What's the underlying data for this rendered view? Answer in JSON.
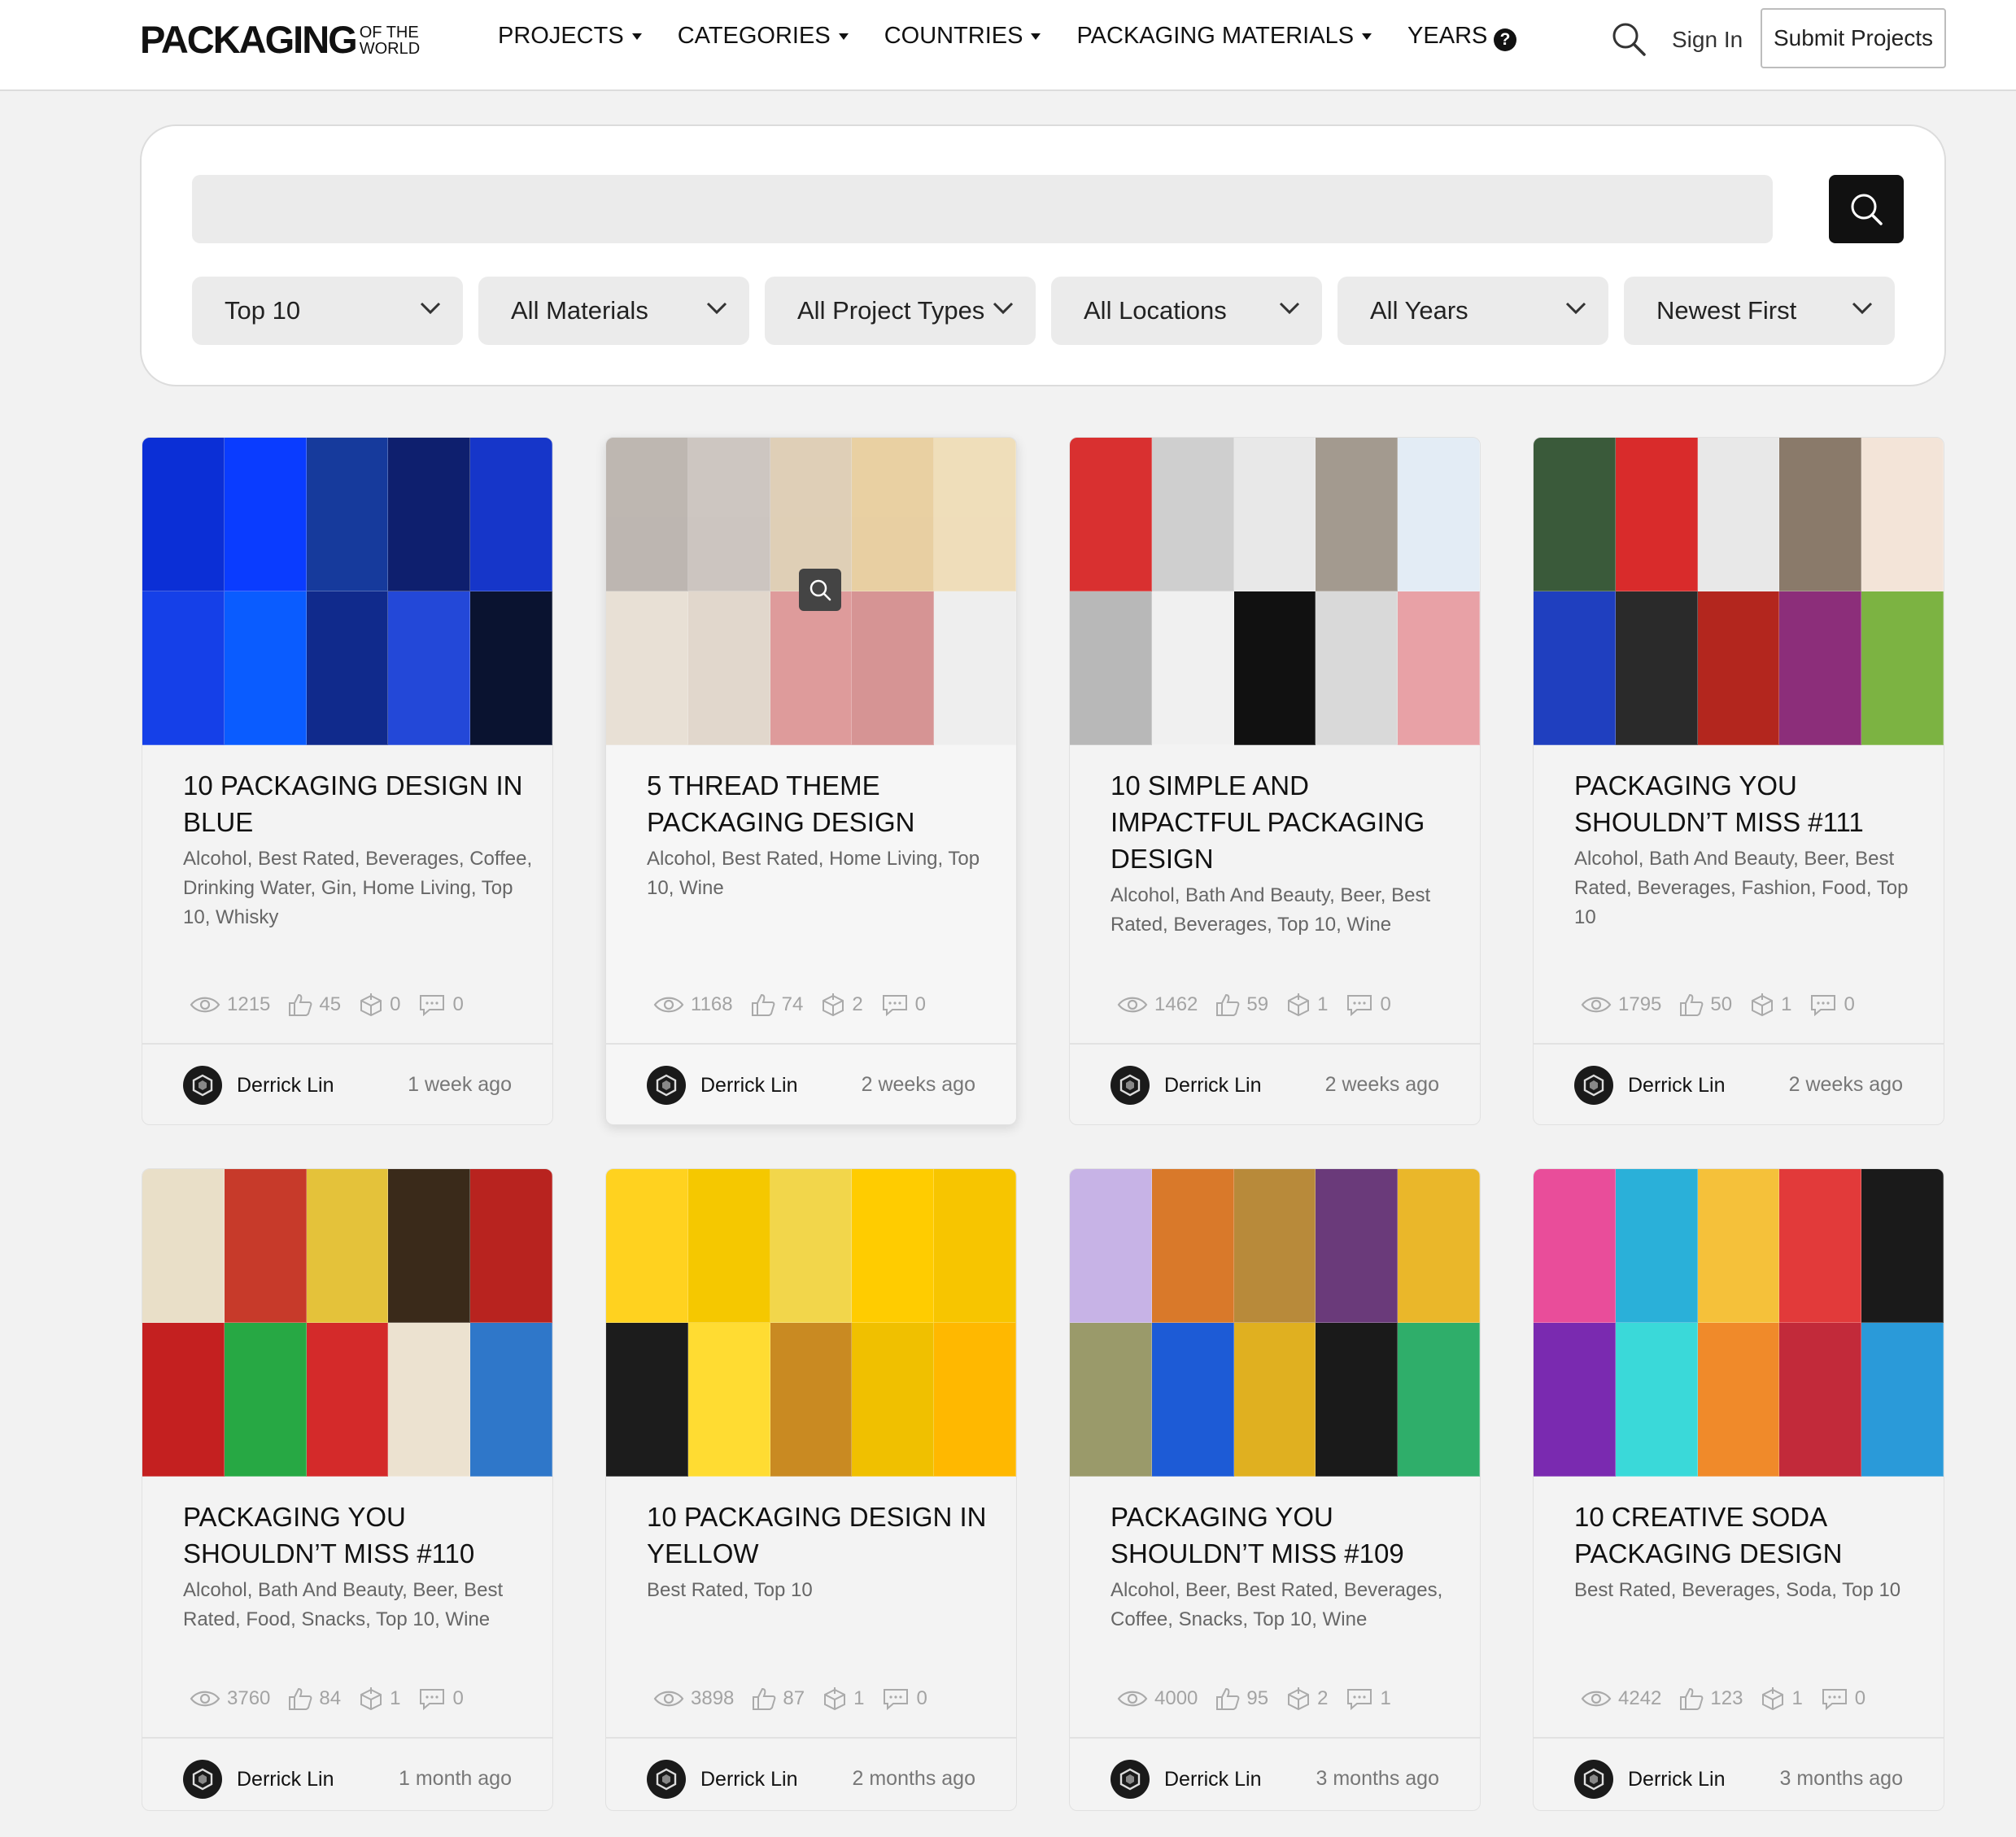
{
  "header": {
    "logo_main": "PACKAGING",
    "logo_sub1": "OF THE",
    "logo_sub2": "WORLD",
    "nav": [
      "PROJECTS",
      "CATEGORIES",
      "COUNTRIES",
      "PACKAGING MATERIALS",
      "YEARS"
    ],
    "help_label": "?",
    "sign_in": "Sign In",
    "submit": "Submit Projects"
  },
  "search": {
    "placeholder": "",
    "value": ""
  },
  "filters": [
    "Top 10",
    "All Materials",
    "All Project Types",
    "All Locations",
    "All Years",
    "Newest First"
  ],
  "cards": [
    {
      "title": "10 PACKAGING DESIGN IN BLUE",
      "tags": "Alcohol, Best Rated, Beverages, Coffee, Drinking Water, Gin, Home Living, Top 10, Whisky",
      "views": "1215",
      "likes": "45",
      "saves": "0",
      "comments": "0",
      "author": "Derrick Lin",
      "time": "1 week ago",
      "palette": [
        "#0b2fd6",
        "#0a3cff",
        "#163a9c",
        "#0e1f6e",
        "#1636c9",
        "#1540e8",
        "#0a5cff",
        "#102a8c",
        "#2348d8",
        "#0a1330"
      ]
    },
    {
      "title": "5 THREAD THEME PACKAGING DESIGN",
      "tags": "Alcohol, Best Rated, Home Living, Top 10, Wine",
      "views": "1168",
      "likes": "74",
      "saves": "2",
      "comments": "0",
      "author": "Derrick Lin",
      "time": "2 weeks ago",
      "palette": [
        "#7a6a5e",
        "#9b8c80",
        "#c4a06a",
        "#d9a23d",
        "#e7c072",
        "#d8c6ae",
        "#c9b39a",
        "#c22f2f",
        "#b11f1f",
        "#e6e6e6"
      ]
    },
    {
      "title": "10 SIMPLE AND IMPACTFUL PACKAGING DESIGN",
      "tags": "Alcohol, Bath And Beauty, Beer, Best Rated, Beverages, Top 10, Wine",
      "views": "1462",
      "likes": "59",
      "saves": "1",
      "comments": "0",
      "author": "Derrick Lin",
      "time": "2 weeks ago",
      "palette": [
        "#d93030",
        "#cfcfcf",
        "#e8e8e8",
        "#a39a8f",
        "#e3ecf5",
        "#b8b8b8",
        "#f0f0f0",
        "#111111",
        "#d9d9d9",
        "#e8a1a6"
      ]
    },
    {
      "title": "PACKAGING YOU SHOULDN’T MISS #111",
      "tags": "Alcohol, Bath And Beauty, Beer, Best Rated, Beverages, Fashion, Food, Top 10",
      "views": "1795",
      "likes": "50",
      "saves": "1",
      "comments": "0",
      "author": "Derrick Lin",
      "time": "2 weeks ago",
      "palette": [
        "#3a5a3a",
        "#d92b2b",
        "#e8e8e8",
        "#8a7a6a",
        "#f3e4d8",
        "#1f3fbf",
        "#2a2a2a",
        "#b3261e",
        "#8c2e7a",
        "#7cb342"
      ]
    },
    {
      "title": "PACKAGING YOU SHOULDN’T MISS #110",
      "tags": "Alcohol, Bath And Beauty, Beer, Best Rated, Food, Snacks, Top 10, Wine",
      "views": "3760",
      "likes": "84",
      "saves": "1",
      "comments": "0",
      "author": "Derrick Lin",
      "time": "1 month ago",
      "palette": [
        "#e9dfc8",
        "#c73a2a",
        "#e4c23a",
        "#3a2a1a",
        "#b8231f",
        "#c42020",
        "#27a844",
        "#d42a2a",
        "#ece2d0",
        "#2f77c9"
      ]
    },
    {
      "title": "10 PACKAGING DESIGN IN YELLOW",
      "tags": "Best Rated, Top 10",
      "views": "3898",
      "likes": "87",
      "saves": "1",
      "comments": "0",
      "author": "Derrick Lin",
      "time": "2 months ago",
      "palette": [
        "#ffd21f",
        "#f5c800",
        "#f2d64b",
        "#ffcc00",
        "#f7c500",
        "#1c1c1c",
        "#ffdc32",
        "#c98a22",
        "#f0c000",
        "#ffb800"
      ]
    },
    {
      "title": "PACKAGING YOU SHOULDN’T MISS #109",
      "tags": "Alcohol, Beer, Best Rated, Beverages, Coffee, Snacks, Top 10, Wine",
      "views": "4000",
      "likes": "95",
      "saves": "2",
      "comments": "1",
      "author": "Derrick Lin",
      "time": "3 months ago",
      "palette": [
        "#c7b3e6",
        "#d9792a",
        "#b88a3a",
        "#6a3a7a",
        "#eab72a",
        "#9a9a6a",
        "#1d5bd6",
        "#e0b020",
        "#1a1a1a",
        "#2fae6a"
      ]
    },
    {
      "title": "10 CREATIVE SODA PACKAGING DESIGN",
      "tags": "Best Rated, Beverages, Soda, Top 10",
      "views": "4242",
      "likes": "123",
      "saves": "1",
      "comments": "0",
      "author": "Derrick Lin",
      "time": "3 months ago",
      "palette": [
        "#e94d9a",
        "#2ab0d9",
        "#f5c13a",
        "#e23a3a",
        "#1a1a1a",
        "#7a2ab0",
        "#3ad9d9",
        "#f08a2a",
        "#c22a3a",
        "#2a9ad9"
      ]
    }
  ]
}
